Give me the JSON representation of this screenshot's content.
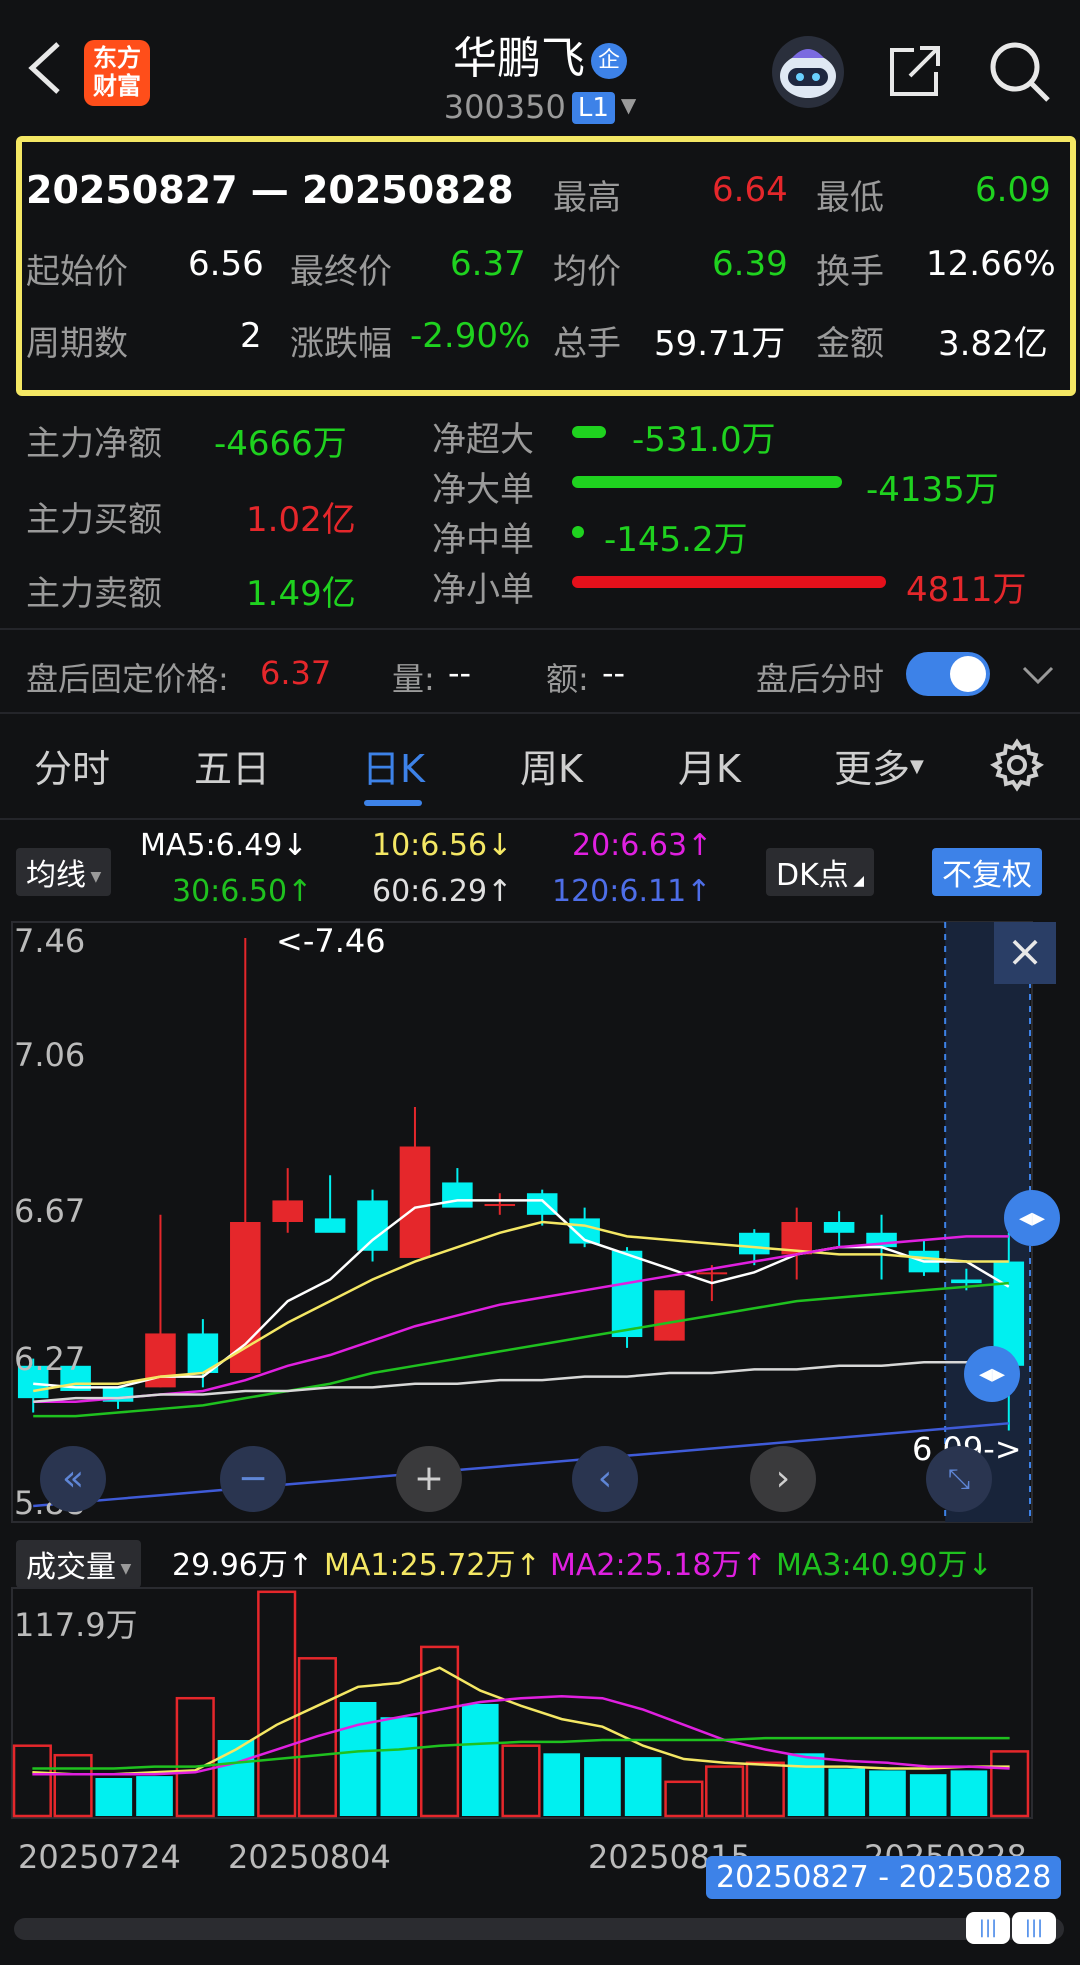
{
  "header": {
    "logo_line1": "东方",
    "logo_line2": "财富",
    "title": "华鹏飞",
    "qi_badge": "企",
    "code": "300350",
    "level": "L1",
    "back_icon": "back-arrow-icon",
    "robot_icon": "robot-assistant-icon",
    "share_icon": "share-icon",
    "search_icon": "search-icon"
  },
  "range_stats": {
    "range": "20250827 — 20250828",
    "high_label": "最高",
    "high": "6.64",
    "low_label": "最低",
    "low": "6.09",
    "open_label": "起始价",
    "open": "6.56",
    "close_label": "最终价",
    "close": "6.37",
    "avg_label": "均价",
    "avg": "6.39",
    "turnover_label": "换手",
    "turnover": "12.66%",
    "periods_label": "周期数",
    "periods": "2",
    "change_label": "涨跌幅",
    "change": "-2.90%",
    "volume_label": "总手",
    "volume": "59.71万",
    "amount_label": "金额",
    "amount": "3.82亿"
  },
  "capital_flow": {
    "main_net_label": "主力净额",
    "main_net": "-4666万",
    "main_buy_label": "主力买额",
    "main_buy": "1.02亿",
    "main_sell_label": "主力卖额",
    "main_sell": "1.49亿",
    "super_label": "净超大",
    "super": "-531.0万",
    "large_label": "净大单",
    "large": "-4135万",
    "medium_label": "净中单",
    "medium": "-145.2万",
    "small_label": "净小单",
    "small": "4811万"
  },
  "after_hours": {
    "fixed_price_label": "盘后固定价格:",
    "fixed_price": "6.37",
    "vol_label": "量:",
    "vol": "--",
    "amt_label": "额:",
    "amt": "--",
    "toggle_label": "盘后分时",
    "toggle_on": true
  },
  "tabs": [
    "分时",
    "五日",
    "日K",
    "周K",
    "月K",
    "更多"
  ],
  "active_tab": "日K",
  "ma_bar": {
    "selector": "均线",
    "ma5": "MA5:6.49↓",
    "ma10": "10:6.56↓",
    "ma20": "20:6.63↑",
    "ma30": "30:6.50↑",
    "ma60": "60:6.29↑",
    "ma120": "120:6.11↑",
    "dk": "DK点",
    "fq": "不复权"
  },
  "colors": {
    "up": "#e5272b",
    "down": "#00f0f0",
    "ma5": "#ffffff",
    "ma10": "#f4e764",
    "ma20": "#e020e0",
    "ma30": "#1fc11f",
    "ma60": "#d8d8d8",
    "ma120": "#3f5bd8",
    "accent": "#3d82e8"
  },
  "chart_data": [
    {
      "type": "candlestick",
      "ylim": [
        5.88,
        7.46
      ],
      "y_ticks": [
        "7.46",
        "7.06",
        "6.67",
        "6.27",
        "5.88"
      ],
      "max_annotation": "<-7.46",
      "min_annotation": "6.09->",
      "candles": [
        {
          "o": 6.27,
          "h": 6.29,
          "l": 6.14,
          "c": 6.18
        },
        {
          "o": 6.27,
          "h": 6.27,
          "l": 6.21,
          "c": 6.2
        },
        {
          "o": 6.21,
          "h": 6.21,
          "l": 6.15,
          "c": 6.17
        },
        {
          "o": 6.21,
          "h": 6.69,
          "l": 6.21,
          "c": 6.36
        },
        {
          "o": 6.36,
          "h": 6.4,
          "l": 6.21,
          "c": 6.25
        },
        {
          "o": 6.25,
          "h": 7.46,
          "l": 6.25,
          "c": 6.67
        },
        {
          "o": 6.67,
          "h": 6.82,
          "l": 6.64,
          "c": 6.73
        },
        {
          "o": 6.68,
          "h": 6.8,
          "l": 6.65,
          "c": 6.64
        },
        {
          "o": 6.73,
          "h": 6.76,
          "l": 6.56,
          "c": 6.59
        },
        {
          "o": 6.57,
          "h": 6.99,
          "l": 6.57,
          "c": 6.88
        },
        {
          "o": 6.78,
          "h": 6.82,
          "l": 6.72,
          "c": 6.71
        },
        {
          "o": 6.72,
          "h": 6.75,
          "l": 6.69,
          "c": 6.72
        },
        {
          "o": 6.75,
          "h": 6.76,
          "l": 6.66,
          "c": 6.69
        },
        {
          "o": 6.68,
          "h": 6.71,
          "l": 6.6,
          "c": 6.61
        },
        {
          "o": 6.59,
          "h": 6.6,
          "l": 6.32,
          "c": 6.35
        },
        {
          "o": 6.34,
          "h": 6.48,
          "l": 6.34,
          "c": 6.48
        },
        {
          "o": 6.53,
          "h": 6.55,
          "l": 6.45,
          "c": 6.53
        },
        {
          "o": 6.64,
          "h": 6.65,
          "l": 6.55,
          "c": 6.58
        },
        {
          "o": 6.58,
          "h": 6.71,
          "l": 6.51,
          "c": 6.67
        },
        {
          "o": 6.67,
          "h": 6.7,
          "l": 6.6,
          "c": 6.64
        },
        {
          "o": 6.64,
          "h": 6.69,
          "l": 6.51,
          "c": 6.6
        },
        {
          "o": 6.59,
          "h": 6.62,
          "l": 6.52,
          "c": 6.53
        },
        {
          "o": 6.51,
          "h": 6.54,
          "l": 6.48,
          "c": 6.5
        },
        {
          "o": 6.56,
          "h": 6.64,
          "l": 6.09,
          "c": 6.27
        }
      ],
      "ma_series": [
        {
          "name": "MA5",
          "values": [
            6.22,
            6.21,
            6.21,
            6.24,
            6.24,
            6.33,
            6.45,
            6.51,
            6.62,
            6.71,
            6.73,
            6.73,
            6.73,
            6.62,
            6.58,
            6.54,
            6.5,
            6.53,
            6.58,
            6.6,
            6.6,
            6.56,
            6.56,
            6.49
          ]
        },
        {
          "name": "MA10",
          "values": [
            6.2,
            6.22,
            6.22,
            6.24,
            6.25,
            6.32,
            6.39,
            6.45,
            6.51,
            6.56,
            6.6,
            6.64,
            6.67,
            6.66,
            6.63,
            6.62,
            6.61,
            6.6,
            6.59,
            6.58,
            6.58,
            6.57,
            6.56,
            6.56
          ]
        },
        {
          "name": "MA20",
          "values": [
            6.17,
            6.17,
            6.18,
            6.19,
            6.2,
            6.23,
            6.27,
            6.3,
            6.34,
            6.38,
            6.41,
            6.44,
            6.46,
            6.48,
            6.5,
            6.52,
            6.54,
            6.56,
            6.58,
            6.6,
            6.61,
            6.62,
            6.63,
            6.63
          ]
        },
        {
          "name": "MA30",
          "values": [
            6.13,
            6.13,
            6.14,
            6.15,
            6.16,
            6.18,
            6.2,
            6.22,
            6.25,
            6.27,
            6.29,
            6.31,
            6.33,
            6.35,
            6.37,
            6.39,
            6.41,
            6.43,
            6.45,
            6.46,
            6.47,
            6.48,
            6.49,
            6.5
          ]
        },
        {
          "name": "MA60",
          "values": [
            6.17,
            6.18,
            6.18,
            6.19,
            6.19,
            6.2,
            6.2,
            6.21,
            6.21,
            6.22,
            6.22,
            6.23,
            6.23,
            6.24,
            6.24,
            6.25,
            6.25,
            6.26,
            6.26,
            6.27,
            6.27,
            6.28,
            6.28,
            6.29
          ]
        },
        {
          "name": "MA120",
          "values": [
            5.88,
            5.89,
            5.9,
            5.91,
            5.92,
            5.93,
            5.94,
            5.95,
            5.96,
            5.97,
            5.98,
            5.99,
            6.0,
            6.01,
            6.02,
            6.03,
            6.04,
            6.05,
            6.06,
            6.07,
            6.08,
            6.09,
            6.1,
            6.11
          ]
        }
      ]
    },
    {
      "type": "bar",
      "title": "成交量",
      "ylim": [
        0,
        117.9
      ],
      "y_top_label": "117.9万",
      "summary": "29.96万↑",
      "ma1": "MA1:25.72万↑",
      "ma2": "MA2:25.18万↑",
      "ma3": "MA3:40.90万↓",
      "x_labels": [
        "20250724",
        "20250804",
        "20250815",
        "20250828"
      ],
      "values": [
        37,
        32,
        20,
        21,
        62,
        40,
        118,
        83,
        60,
        52,
        89,
        59,
        37,
        33,
        31,
        31,
        18,
        26,
        28,
        33,
        25,
        24,
        22,
        24,
        34
      ],
      "up": [
        true,
        true,
        false,
        false,
        true,
        false,
        true,
        true,
        false,
        false,
        true,
        false,
        true,
        false,
        false,
        false,
        true,
        true,
        true,
        false,
        false,
        false,
        false,
        false,
        true
      ],
      "ma_series": [
        {
          "name": "MA1",
          "values": [
            23,
            22,
            22,
            23,
            24,
            35,
            48,
            58,
            68,
            70,
            78,
            66,
            58,
            51,
            47,
            37,
            30,
            28,
            27,
            26,
            26,
            25,
            25,
            26,
            26
          ]
        },
        {
          "name": "MA2",
          "values": [
            22,
            22,
            22,
            22,
            23,
            28,
            35,
            42,
            48,
            52,
            56,
            60,
            62,
            63,
            62,
            56,
            48,
            40,
            35,
            31,
            29,
            28,
            26,
            26,
            25
          ]
        },
        {
          "name": "MA3",
          "values": [
            25,
            25,
            25,
            26,
            26,
            28,
            30,
            32,
            34,
            35,
            37,
            38,
            39,
            39,
            40,
            40,
            40,
            40,
            41,
            41,
            41,
            41,
            41,
            41,
            41
          ]
        }
      ]
    }
  ],
  "selection_badge": "20250827 - 20250828",
  "nav_buttons": [
    "«",
    "−",
    "+",
    "‹",
    "›"
  ],
  "close_icon": "×"
}
